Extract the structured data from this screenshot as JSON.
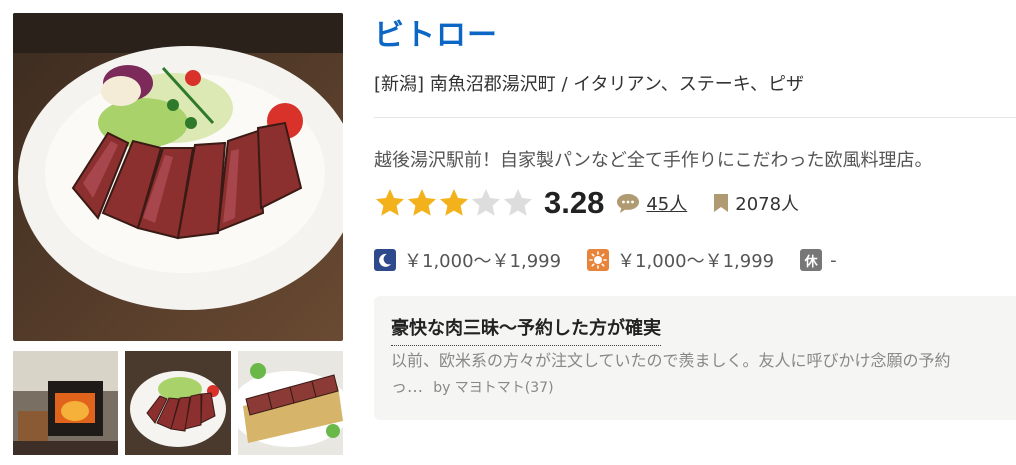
{
  "restaurant": {
    "name": "ビトロー",
    "meta": "[新潟] 南魚沼郡湯沢町 / イタリアン、ステーキ、ピザ",
    "catchphrase": "越後湯沢駅前！自家製パンなど全て手作りにこだわった欧風料理店。",
    "rating": "3.28",
    "rating_value": 3.28,
    "rating_max": 5,
    "review_count": "45人",
    "bookmark_count": "2078人",
    "price_dinner": "￥1,000～￥1,999",
    "price_lunch": "￥1,000～￥1,999",
    "closed_label": "休",
    "closed_value": "-"
  },
  "photos": {
    "main": "steak-bowl-photo",
    "thumbs": [
      "wood-stove-photo",
      "steak-bowl-photo",
      "steak-platter-photo"
    ]
  },
  "review": {
    "title": "豪快な肉三昧～予約した方が確実",
    "line1": "以前、欧米系の方々が注文していたので羨ましく。友人に呼びかけ念願の予約",
    "line2": "っ…",
    "author": "by マヨトマト(37)"
  },
  "colors": {
    "name_link": "#0c67c4",
    "star_on": "#f3b21b",
    "star_off": "#dddddd",
    "review_bg": "#f5f5f3"
  },
  "icons": [
    "moon-icon",
    "sun-icon",
    "closed-day-icon",
    "comment-icon",
    "bookmark-icon",
    "star-icon"
  ]
}
